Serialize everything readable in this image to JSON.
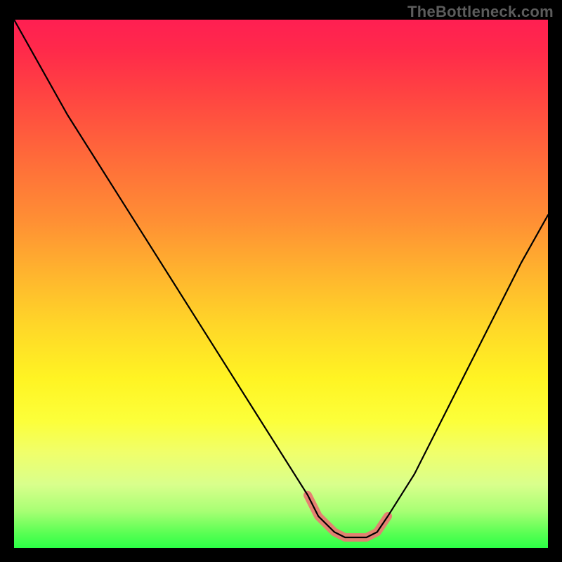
{
  "watermark": "TheBottleneck.com",
  "chart_data": {
    "type": "line",
    "title": "",
    "xlabel": "",
    "ylabel": "",
    "xlim": [
      0,
      100
    ],
    "ylim": [
      0,
      100
    ],
    "grid": false,
    "series": [
      {
        "name": "bottleneck-curve",
        "x": [
          0,
          5,
          10,
          15,
          20,
          25,
          30,
          35,
          40,
          45,
          50,
          55,
          57,
          60,
          62,
          64,
          66,
          68,
          70,
          75,
          80,
          85,
          90,
          95,
          100
        ],
        "values": [
          100,
          91,
          82,
          74,
          66,
          58,
          50,
          42,
          34,
          26,
          18,
          10,
          6,
          3,
          2,
          2,
          2,
          3,
          6,
          14,
          24,
          34,
          44,
          54,
          63
        ]
      }
    ],
    "annotations": [
      {
        "name": "trough-highlight",
        "x_range": [
          55,
          70
        ],
        "y": 2,
        "color": "#e97a72"
      }
    ],
    "background_gradient": {
      "direction": "vertical",
      "stops": [
        {
          "pos": 0.0,
          "color": "#ff1f52"
        },
        {
          "pos": 0.3,
          "color": "#ff7a36"
        },
        {
          "pos": 0.6,
          "color": "#ffe526"
        },
        {
          "pos": 0.85,
          "color": "#e4ff7a"
        },
        {
          "pos": 1.0,
          "color": "#2bff45"
        }
      ]
    }
  }
}
